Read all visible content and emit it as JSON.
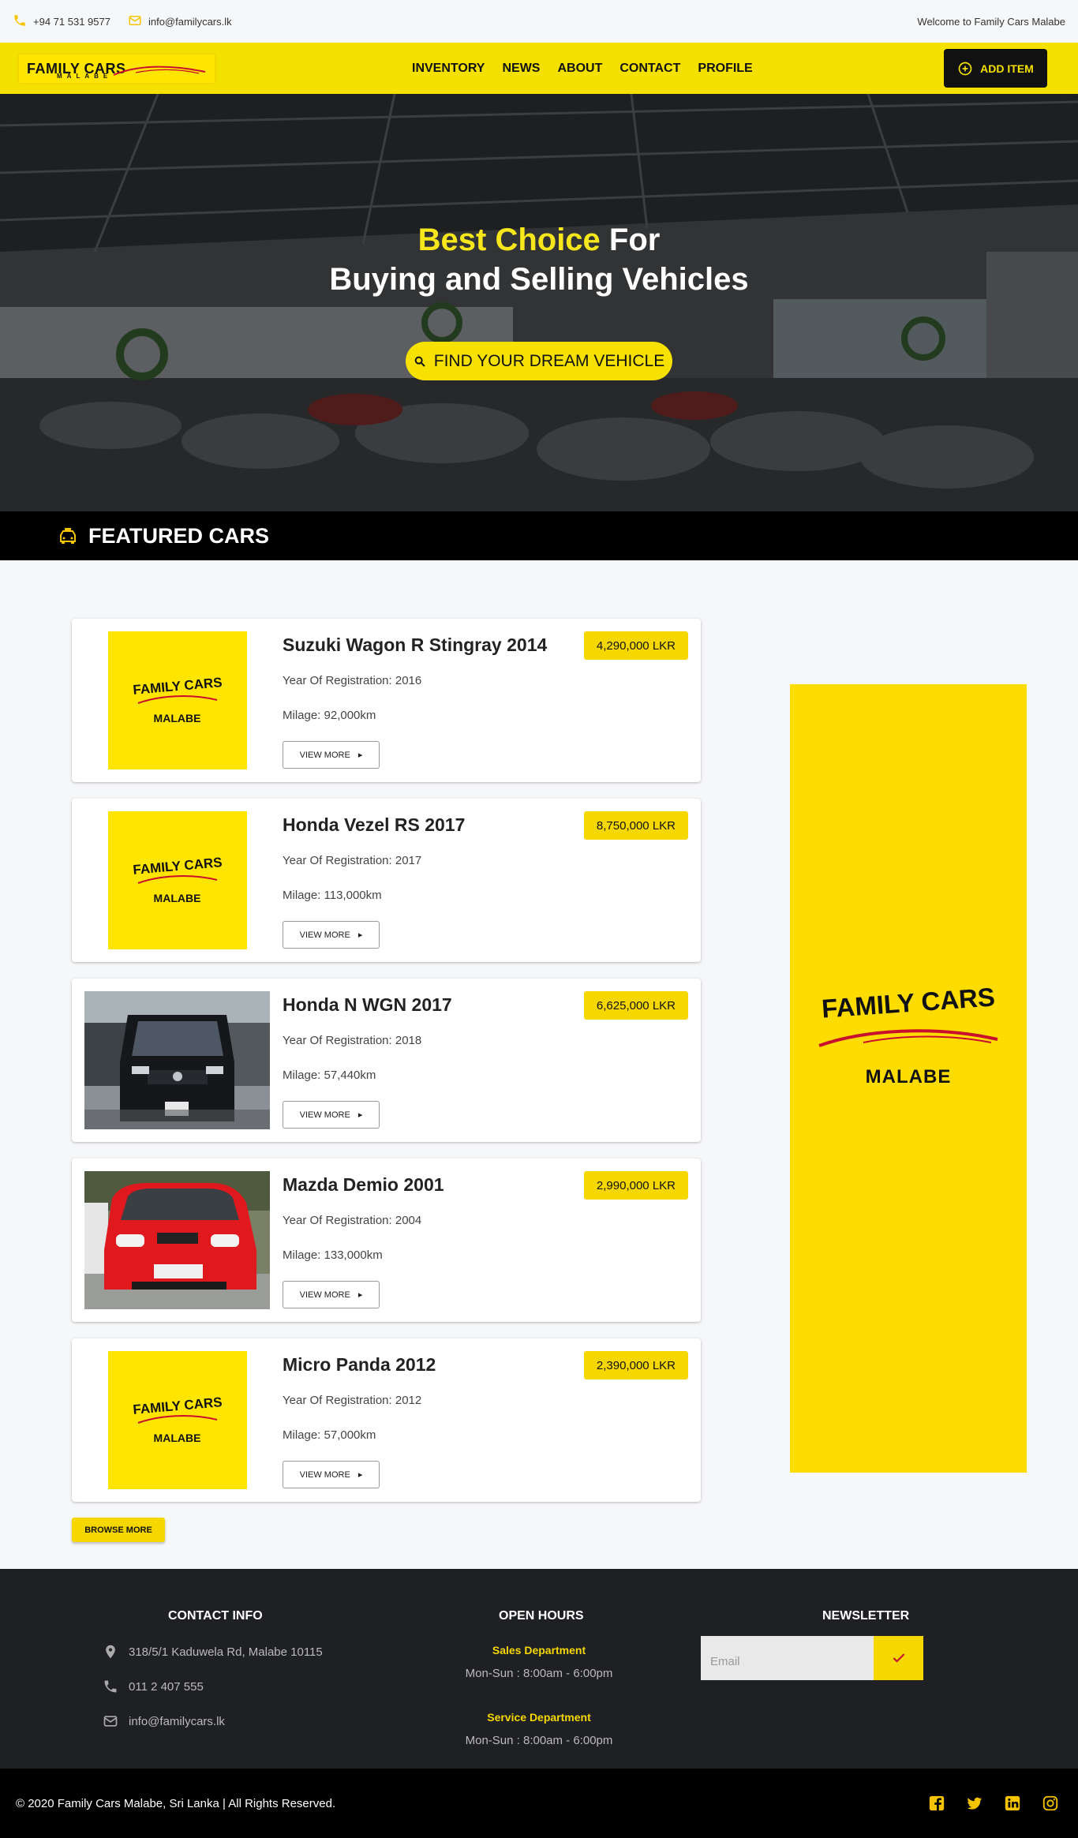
{
  "topbar": {
    "phone": "+94 71 531 9577",
    "email": "info@familycars.lk",
    "welcome": "Welcome to Family Cars Malabe"
  },
  "brand": {
    "logo_line1": "FAMILY CARS",
    "logo_line2": "MALABE",
    "accent": "#f5e100",
    "dark": "#111111"
  },
  "nav": {
    "items": [
      "INVENTORY",
      "NEWS",
      "ABOUT",
      "CONTACT",
      "PROFILE"
    ],
    "add_item": "ADD ITEM"
  },
  "hero": {
    "highlight": "Best Choice",
    "title_rest": "For",
    "title_line2": "Buying and Selling Vehicles",
    "cta": "FIND YOUR DREAM VEHICLE"
  },
  "featured": {
    "heading": "FEATURED CARS",
    "view_more": "VIEW MORE",
    "placeholder_line1": "FAMILY CARS",
    "placeholder_line2": "MALABE",
    "cars": [
      {
        "name": "Suzuki Wagon R Stingray 2014",
        "price": "4,290,000 LKR",
        "registration": "Year Of Registration: 2016",
        "milage": "Milage: 92,000km",
        "image": "placeholder"
      },
      {
        "name": "Honda Vezel RS 2017",
        "price": "8,750,000 LKR",
        "registration": "Year Of Registration: 2017",
        "milage": "Milage: 113,000km",
        "image": "placeholder"
      },
      {
        "name": "Honda N WGN 2017",
        "price": "6,625,000 LKR",
        "registration": "Year Of Registration: 2018",
        "milage": "Milage: 57,440km",
        "image": "photo-black-car"
      },
      {
        "name": "Mazda Demio 2001",
        "price": "2,990,000 LKR",
        "registration": "Year Of Registration: 2004",
        "milage": "Milage: 133,000km",
        "image": "photo-red-car"
      },
      {
        "name": "Micro Panda 2012",
        "price": "2,390,000 LKR",
        "registration": "Year Of Registration: 2012",
        "milage": "Milage: 57,000km",
        "image": "placeholder"
      }
    ],
    "browse_more": "BROWSE MORE"
  },
  "sidebar_ad": {
    "line1": "FAMILY CARS",
    "line2": "MALABE"
  },
  "footer": {
    "contact_heading": "CONTACT INFO",
    "address": "318/5/1 Kaduwela Rd, Malabe 10115",
    "phone": "011 2 407 555",
    "email": "info@familycars.lk",
    "hours_heading": "OPEN HOURS",
    "sales_dept": "Sales Department",
    "sales_hours": "Mon-Sun : 8:00am - 6:00pm",
    "service_dept": "Service Department",
    "service_hours": "Mon-Sun : 8:00am - 6:00pm",
    "newsletter_heading": "NEWSLETTER",
    "email_placeholder": "Email",
    "copyright": "© 2020 Family Cars Malabe, Sri Lanka | All Rights Reserved.",
    "social_icons": [
      "facebook-icon",
      "twitter-icon",
      "linkedin-icon",
      "instagram-icon"
    ]
  }
}
